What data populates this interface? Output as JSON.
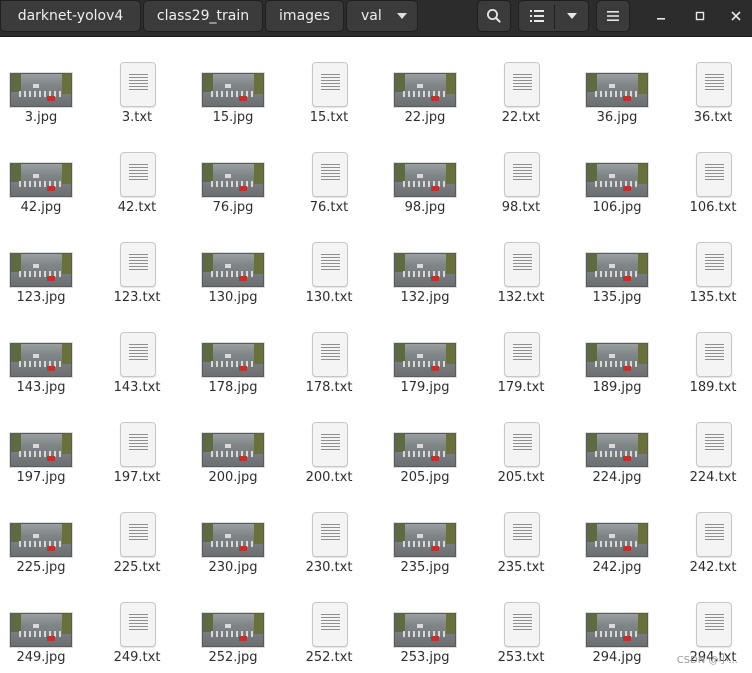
{
  "breadcrumb": [
    {
      "label": "darknet-yolov4"
    },
    {
      "label": "class29_train"
    },
    {
      "label": "images"
    },
    {
      "label": "val"
    }
  ],
  "toolbar": {
    "search_icon": "search-icon",
    "view_icon": "list-view-icon",
    "view_options_icon": "chevron-down-icon",
    "menu_icon": "hamburger-menu-icon"
  },
  "window_controls": [
    "minimize-icon",
    "maximize-icon",
    "close-icon"
  ],
  "files": [
    {
      "name": "3.jpg",
      "type": "image"
    },
    {
      "name": "3.txt",
      "type": "text"
    },
    {
      "name": "15.jpg",
      "type": "image"
    },
    {
      "name": "15.txt",
      "type": "text"
    },
    {
      "name": "22.jpg",
      "type": "image"
    },
    {
      "name": "22.txt",
      "type": "text"
    },
    {
      "name": "36.jpg",
      "type": "image"
    },
    {
      "name": "36.txt",
      "type": "text"
    },
    {
      "name": "42.jpg",
      "type": "image"
    },
    {
      "name": "42.txt",
      "type": "text"
    },
    {
      "name": "76.jpg",
      "type": "image"
    },
    {
      "name": "76.txt",
      "type": "text"
    },
    {
      "name": "98.jpg",
      "type": "image"
    },
    {
      "name": "98.txt",
      "type": "text"
    },
    {
      "name": "106.jpg",
      "type": "image"
    },
    {
      "name": "106.txt",
      "type": "text"
    },
    {
      "name": "123.jpg",
      "type": "image"
    },
    {
      "name": "123.txt",
      "type": "text"
    },
    {
      "name": "130.jpg",
      "type": "image"
    },
    {
      "name": "130.txt",
      "type": "text"
    },
    {
      "name": "132.jpg",
      "type": "image"
    },
    {
      "name": "132.txt",
      "type": "text"
    },
    {
      "name": "135.jpg",
      "type": "image"
    },
    {
      "name": "135.txt",
      "type": "text"
    },
    {
      "name": "143.jpg",
      "type": "image"
    },
    {
      "name": "143.txt",
      "type": "text"
    },
    {
      "name": "178.jpg",
      "type": "image"
    },
    {
      "name": "178.txt",
      "type": "text"
    },
    {
      "name": "179.jpg",
      "type": "image"
    },
    {
      "name": "179.txt",
      "type": "text"
    },
    {
      "name": "189.jpg",
      "type": "image"
    },
    {
      "name": "189.txt",
      "type": "text"
    },
    {
      "name": "197.jpg",
      "type": "image"
    },
    {
      "name": "197.txt",
      "type": "text"
    },
    {
      "name": "200.jpg",
      "type": "image"
    },
    {
      "name": "200.txt",
      "type": "text"
    },
    {
      "name": "205.jpg",
      "type": "image"
    },
    {
      "name": "205.txt",
      "type": "text"
    },
    {
      "name": "224.jpg",
      "type": "image"
    },
    {
      "name": "224.txt",
      "type": "text"
    },
    {
      "name": "225.jpg",
      "type": "image"
    },
    {
      "name": "225.txt",
      "type": "text"
    },
    {
      "name": "230.jpg",
      "type": "image"
    },
    {
      "name": "230.txt",
      "type": "text"
    },
    {
      "name": "235.jpg",
      "type": "image"
    },
    {
      "name": "235.txt",
      "type": "text"
    },
    {
      "name": "242.jpg",
      "type": "image"
    },
    {
      "name": "242.txt",
      "type": "text"
    },
    {
      "name": "249.jpg",
      "type": "image"
    },
    {
      "name": "249.txt",
      "type": "text"
    },
    {
      "name": "252.jpg",
      "type": "image"
    },
    {
      "name": "252.txt",
      "type": "text"
    },
    {
      "name": "253.jpg",
      "type": "image"
    },
    {
      "name": "253.txt",
      "type": "text"
    },
    {
      "name": "294.jpg",
      "type": "image"
    },
    {
      "name": "294.txt",
      "type": "text"
    }
  ],
  "watermark": "CSDN @小..."
}
